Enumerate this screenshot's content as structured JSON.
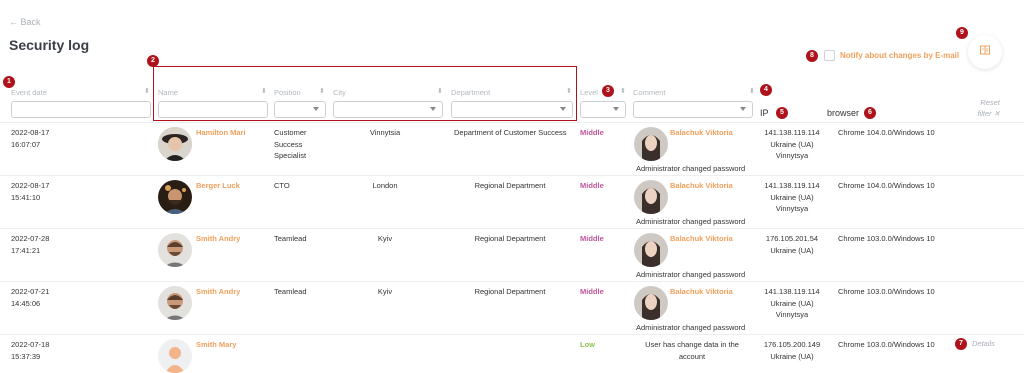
{
  "nav": {
    "back_label": "← Back"
  },
  "page": {
    "title": "Security log"
  },
  "notify": {
    "label": "Notify about changes by E-mail"
  },
  "badges": [
    "1",
    "2",
    "3",
    "4",
    "5",
    "6",
    "7",
    "8",
    "9"
  ],
  "columns": {
    "event_date": "Event date",
    "name": "Name",
    "position": "Position",
    "city": "City",
    "department": "Department",
    "level": "Level",
    "comment": "Comment",
    "ip": "IP",
    "browser": "browser",
    "reset": "Reset filter ✕"
  },
  "rows": [
    {
      "date": "2022-08-17",
      "time": "16:07:07",
      "name": "Hamilton Mari",
      "position": "Customer Success Specialist",
      "city": "Vinnytsia",
      "department": "Department of Customer Success",
      "level": "Middle",
      "admin": "Balachuk Viktoria",
      "comment": "Administrator changed password",
      "ip": "141.138.119.114",
      "country": "Ukraine (UA)",
      "region": "Vinnytsya",
      "browser": "Chrome 104.0.0/Windows 10"
    },
    {
      "date": "2022-08-17",
      "time": "15:41:10",
      "name": "Berger Luck",
      "position": "CTO",
      "city": "London",
      "department": "Regional Department",
      "level": "Middle",
      "admin": "Balachuk Viktoria",
      "comment": "Administrator changed password",
      "ip": "141.138.119.114",
      "country": "Ukraine (UA)",
      "region": "Vinnytsya",
      "browser": "Chrome 104.0.0/Windows 10"
    },
    {
      "date": "2022-07-28",
      "time": "17:41:21",
      "name": "Smith Andry",
      "position": "Teamlead",
      "city": "Kyiv",
      "department": "Regional Department",
      "level": "Middle",
      "admin": "Balachuk Viktoria",
      "comment": "Administrator changed password",
      "ip": "176.105.201.54",
      "country": "Ukraine (UA)",
      "region": "",
      "browser": "Chrome 103.0.0/Windows 10"
    },
    {
      "date": "2022-07-21",
      "time": "14:45:06",
      "name": "Smith Andry",
      "position": "Teamlead",
      "city": "Kyiv",
      "department": "Regional Department",
      "level": "Middle",
      "admin": "Balachuk Viktoria",
      "comment": "Administrator changed password",
      "ip": "141.138.119.114",
      "country": "Ukraine (UA)",
      "region": "Vinnytsya",
      "browser": "Chrome 103.0.0/Windows 10"
    },
    {
      "date": "2022-07-18",
      "time": "15:37:39",
      "name": "Smith Mary",
      "position": "",
      "city": "",
      "department": "",
      "level": "Low",
      "admin": "",
      "comment": "User has change data in the account",
      "ip": "176.105.200.149",
      "country": "Ukraine (UA)",
      "region": "",
      "browser": "Chrome 103.0.0/Windows 10",
      "details": "Details"
    }
  ],
  "colors": {
    "accent": "#f0a05c",
    "badge": "#b0121c",
    "middle": "#c2569a",
    "low": "#8cc152"
  }
}
